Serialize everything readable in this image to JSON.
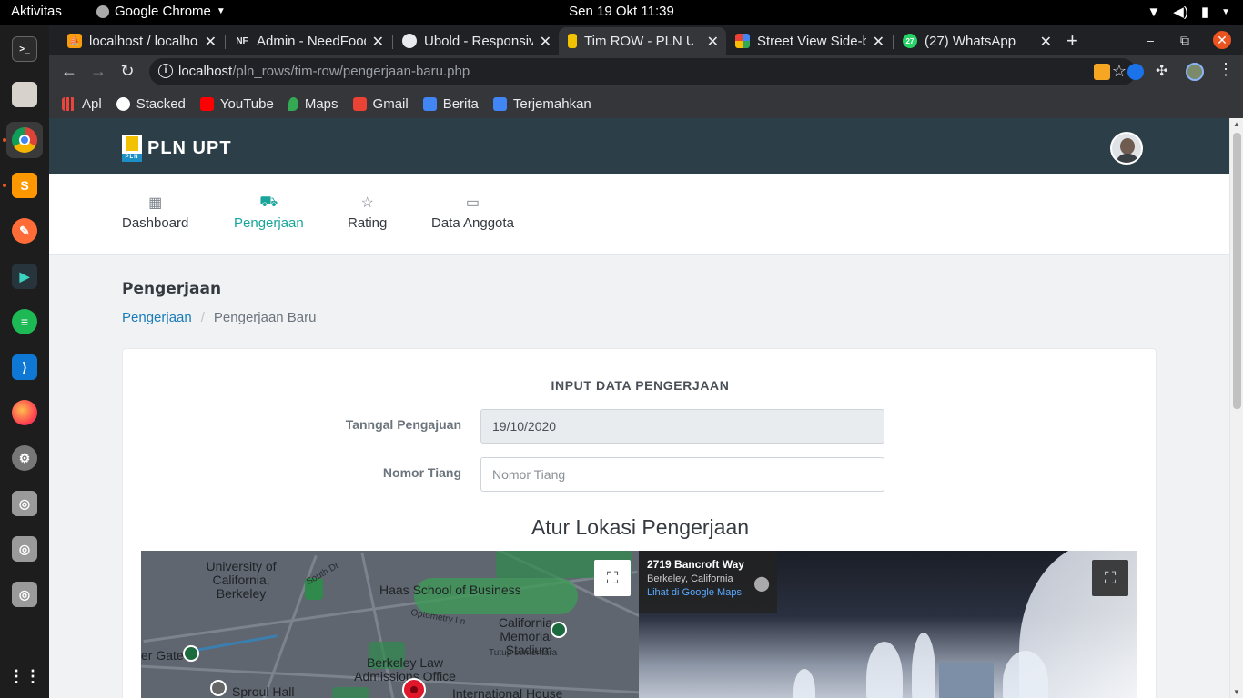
{
  "system": {
    "activities": "Aktivitas",
    "app_name": "Google Chrome",
    "clock": "Sen 19 Okt  11:39"
  },
  "browser": {
    "tabs": [
      {
        "title": "localhost / localhost",
        "icon": "phpmyadmin-icon"
      },
      {
        "title": "Admin - NeedFood",
        "icon": "nf-icon"
      },
      {
        "title": "Ubold - Responsive",
        "icon": "globe-icon"
      },
      {
        "title": "Tim ROW - PLN UPT",
        "icon": "pln-icon"
      },
      {
        "title": "Street View Side-by-",
        "icon": "maps-icon"
      },
      {
        "title": "(27) WhatsApp",
        "icon": "whatsapp-icon"
      }
    ],
    "url_host": "localhost",
    "url_path": "/pln_rows/tim-row/pengerjaan-baru.php",
    "bookmarks": [
      {
        "label": "Apl",
        "color": "#e8453c"
      },
      {
        "label": "Stacked",
        "color": "#ffffff"
      },
      {
        "label": "YouTube",
        "color": "#ff0000"
      },
      {
        "label": "Maps",
        "color": "#34a853"
      },
      {
        "label": "Gmail",
        "color": "#ea4335"
      },
      {
        "label": "Berita",
        "color": "#4285f4"
      },
      {
        "label": "Terjemahkan",
        "color": "#4285f4"
      }
    ]
  },
  "page": {
    "brand": "PLN UPT",
    "menu": [
      {
        "label": "Dashboard",
        "icon": "dashboard-icon"
      },
      {
        "label": "Pengerjaan",
        "icon": "truck-icon"
      },
      {
        "label": "Rating",
        "icon": "star-icon"
      },
      {
        "label": "Data Anggota",
        "icon": "id-card-icon"
      }
    ],
    "title": "Pengerjaan",
    "breadcrumb": {
      "parent": "Pengerjaan",
      "current": "Pengerjaan Baru"
    },
    "form": {
      "heading": "INPUT DATA PENGERJAAN",
      "date_label": "Tanngal Pengajuan",
      "date_value": "19/10/2020",
      "pole_label": "Nomor Tiang",
      "pole_placeholder": "Nomor Tiang"
    },
    "map_title": "Atur Lokasi Pengerjaan",
    "map_labels": {
      "univ": "University of California, Berkeley",
      "haas": "Haas School of Business",
      "stadium": "California Memorial Stadium",
      "stadium_note": "Tutup sementara",
      "law": "Berkeley Law Admissions Office",
      "sproul": "Sproul Hall",
      "intl": "International House",
      "gate": "er Gate",
      "southdr": "South Dr",
      "optometry": "Optometry Ln"
    },
    "streetview": {
      "address": "2719 Bancroft Way",
      "city": "Berkeley, California",
      "link": "Lihat di Google Maps"
    }
  },
  "colors": {
    "navbar": "#2c3e48",
    "accent": "#1aa59b",
    "link": "#1a7bb9"
  }
}
